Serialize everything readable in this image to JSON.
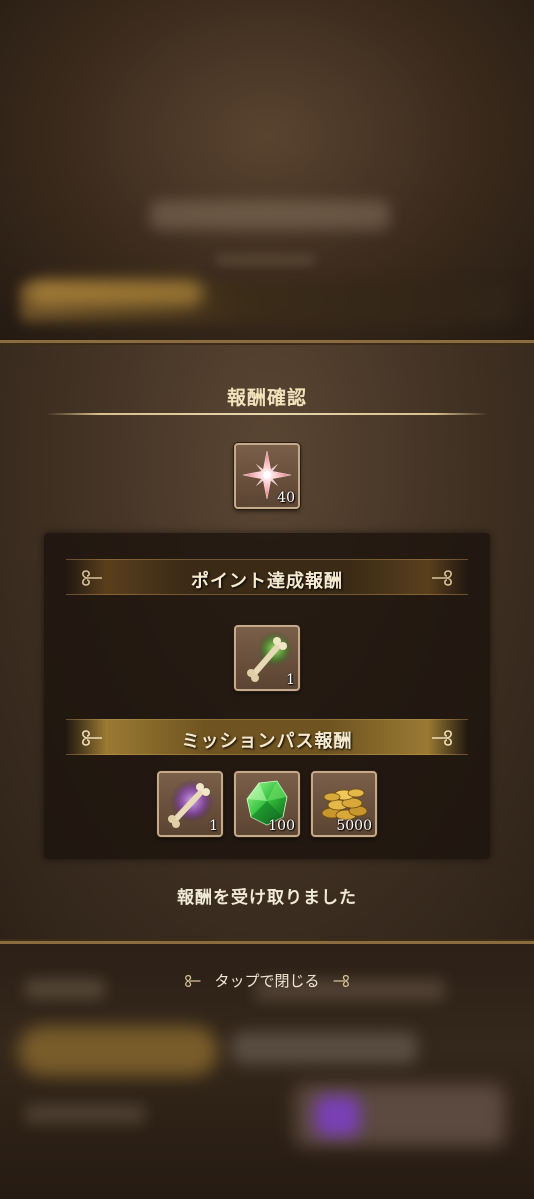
{
  "dialog": {
    "title": "報酬確認",
    "top_reward": {
      "icon": "pink-compass-star-icon",
      "quantity": "40"
    },
    "sections": [
      {
        "title": "ポイント達成報酬",
        "items": [
          {
            "icon": "green-glowing-bone-icon",
            "quantity": "1"
          }
        ]
      },
      {
        "title": "ミッションパス報酬",
        "items": [
          {
            "icon": "purple-glowing-bone-icon",
            "quantity": "1"
          },
          {
            "icon": "green-gem-icon",
            "quantity": "100"
          },
          {
            "icon": "gold-coins-icon",
            "quantity": "5000"
          }
        ]
      }
    ],
    "status": "報酬を受け取りました"
  },
  "close_hint": "タップで閉じる",
  "colors": {
    "panel_border": "#8a6c3e",
    "title_text": "#f2e1bb",
    "item_border": "#c4a98a",
    "gold_header": "#9a7a32"
  }
}
